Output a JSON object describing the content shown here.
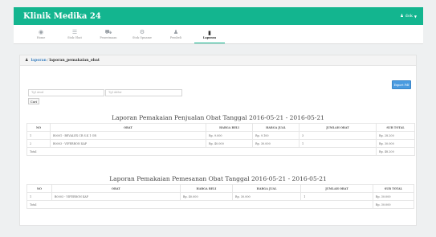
{
  "app": {
    "brand": "Klinik Medika 24",
    "user": "dok"
  },
  "menu": [
    {
      "label": "Home",
      "icon": "dashboard-icon"
    },
    {
      "label": "Stok Obat",
      "icon": "list-icon"
    },
    {
      "label": "Penerimaan",
      "icon": "truck-icon"
    },
    {
      "label": "Stok Opname",
      "icon": "cogs-icon"
    },
    {
      "label": "Pembeli",
      "icon": "user-icon"
    },
    {
      "label": "Laporan",
      "icon": "book-icon"
    }
  ],
  "breadcrumb": {
    "root": "laporan",
    "separator": "/",
    "current": "laporan_pemakaian_obat"
  },
  "filters": {
    "start_placeholder": "Tgl Awal",
    "end_placeholder": "Tgl Akhir",
    "search_label": "Cari",
    "export_label": "Export Pdf"
  },
  "report1": {
    "title": "Laporan Pemakaian Penjualan Obat Tanggal 2016-05-21 - 2016-05-21",
    "headers": [
      "NO",
      "OBAT",
      "HARGA BELI",
      "HARGA JUAL",
      "JUMLAH OBAT",
      "SUB TOTAL"
    ],
    "rows": [
      [
        "1",
        "B0001 - BEVALEX CR S.K 1 OR",
        "Rp. 9.000",
        "Rp. 9.100",
        "3",
        "Rp. 28.200"
      ],
      [
        "2",
        "B0003 - VIFERRON KAP",
        "Rp. 40.000",
        "Rp. 30.000",
        "1",
        "Rp. 30.000"
      ]
    ],
    "total_label": "Total",
    "total_value": "Rp. 48.200"
  },
  "report2": {
    "title": "Laporan Pemakaian Pemesanan Obat Tanggal 2016-05-21 - 2016-05-21",
    "headers": [
      "NO",
      "OBAT",
      "HARGA BELI",
      "HARGA JUAL",
      "JUMLAH OBAT",
      "SUB TOTAL"
    ],
    "rows": [
      [
        "1",
        "B0003 - VIFERRON KAP",
        "Rp. 40.000",
        "Rp. 30.000",
        "1",
        "Rp. 30.000"
      ]
    ],
    "total_label": "Total",
    "total_value": "Rp. 30.000"
  },
  "colors": {
    "navbar": "#13b58f",
    "export_button": "#4a9be0",
    "link": "#3a7fbf"
  }
}
